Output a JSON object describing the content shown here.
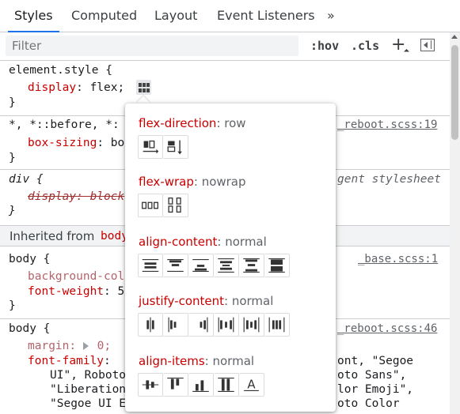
{
  "tabs": [
    "Styles",
    "Computed",
    "Layout",
    "Event Listeners"
  ],
  "tab_more_glyph": "»",
  "toolbar": {
    "filter_placeholder": "Filter",
    "hov": ":hov",
    "cls": ".cls",
    "plus": "+"
  },
  "rules": {
    "element_style": {
      "selector": "element.style {",
      "prop": "display",
      "value": "flex;",
      "close": "}"
    },
    "reboot_universal": {
      "selector": "*, *::before, *:",
      "source": "_reboot.scss:19",
      "prop": "box-sizing",
      "value": "bo",
      "close": "}"
    },
    "div_ua": {
      "selector": "div {",
      "ua_label": "gent stylesheet",
      "prop_struck": "display: block",
      "close": "}"
    },
    "inherited": {
      "label": "Inherited from",
      "element": "body"
    },
    "body_base": {
      "selector": "body {",
      "source": "_base.scss:1",
      "prop1": "background-col",
      "prop2": "font-weight",
      "value2": "5",
      "close": "}"
    },
    "body_reboot": {
      "selector": "body {",
      "source": "_reboot.scss:46",
      "margin_prop": "margin",
      "margin_value": "0;",
      "font_family_prop": "font-family",
      "ff_line1_tail": "ont, \"Segoe",
      "ff_line2_head": "UI\", Roboto",
      "ff_line2_tail": "oto Sans\",",
      "ff_line3_head": "\"Liberation",
      "ff_line3_tail": "lor Emoji\",",
      "ff_line4_head": "\"Segoe UI E",
      "ff_line4_tail": "oto Color"
    }
  },
  "flex_editor": {
    "sections": [
      {
        "name": "flex-direction",
        "value": "row",
        "buttons": [
          "flex-direction-row",
          "flex-direction-column"
        ]
      },
      {
        "name": "flex-wrap",
        "value": "nowrap",
        "buttons": [
          "flex-wrap-nowrap",
          "flex-wrap-wrap"
        ]
      },
      {
        "name": "align-content",
        "value": "normal",
        "buttons": [
          "align-content-center",
          "align-content-flex-start",
          "align-content-flex-end",
          "align-content-space-around",
          "align-content-space-between",
          "align-content-stretch"
        ]
      },
      {
        "name": "justify-content",
        "value": "normal",
        "buttons": [
          "justify-content-center",
          "justify-content-flex-start",
          "justify-content-flex-end",
          "justify-content-space-between",
          "justify-content-space-around",
          "justify-content-space-evenly"
        ]
      },
      {
        "name": "align-items",
        "value": "normal",
        "buttons": [
          "align-items-center",
          "align-items-flex-start",
          "align-items-flex-end",
          "align-items-stretch",
          "align-items-baseline"
        ]
      }
    ]
  },
  "colors": {
    "accent": "#1a73e8",
    "property": "#c80000",
    "muted": "#5f6368"
  }
}
